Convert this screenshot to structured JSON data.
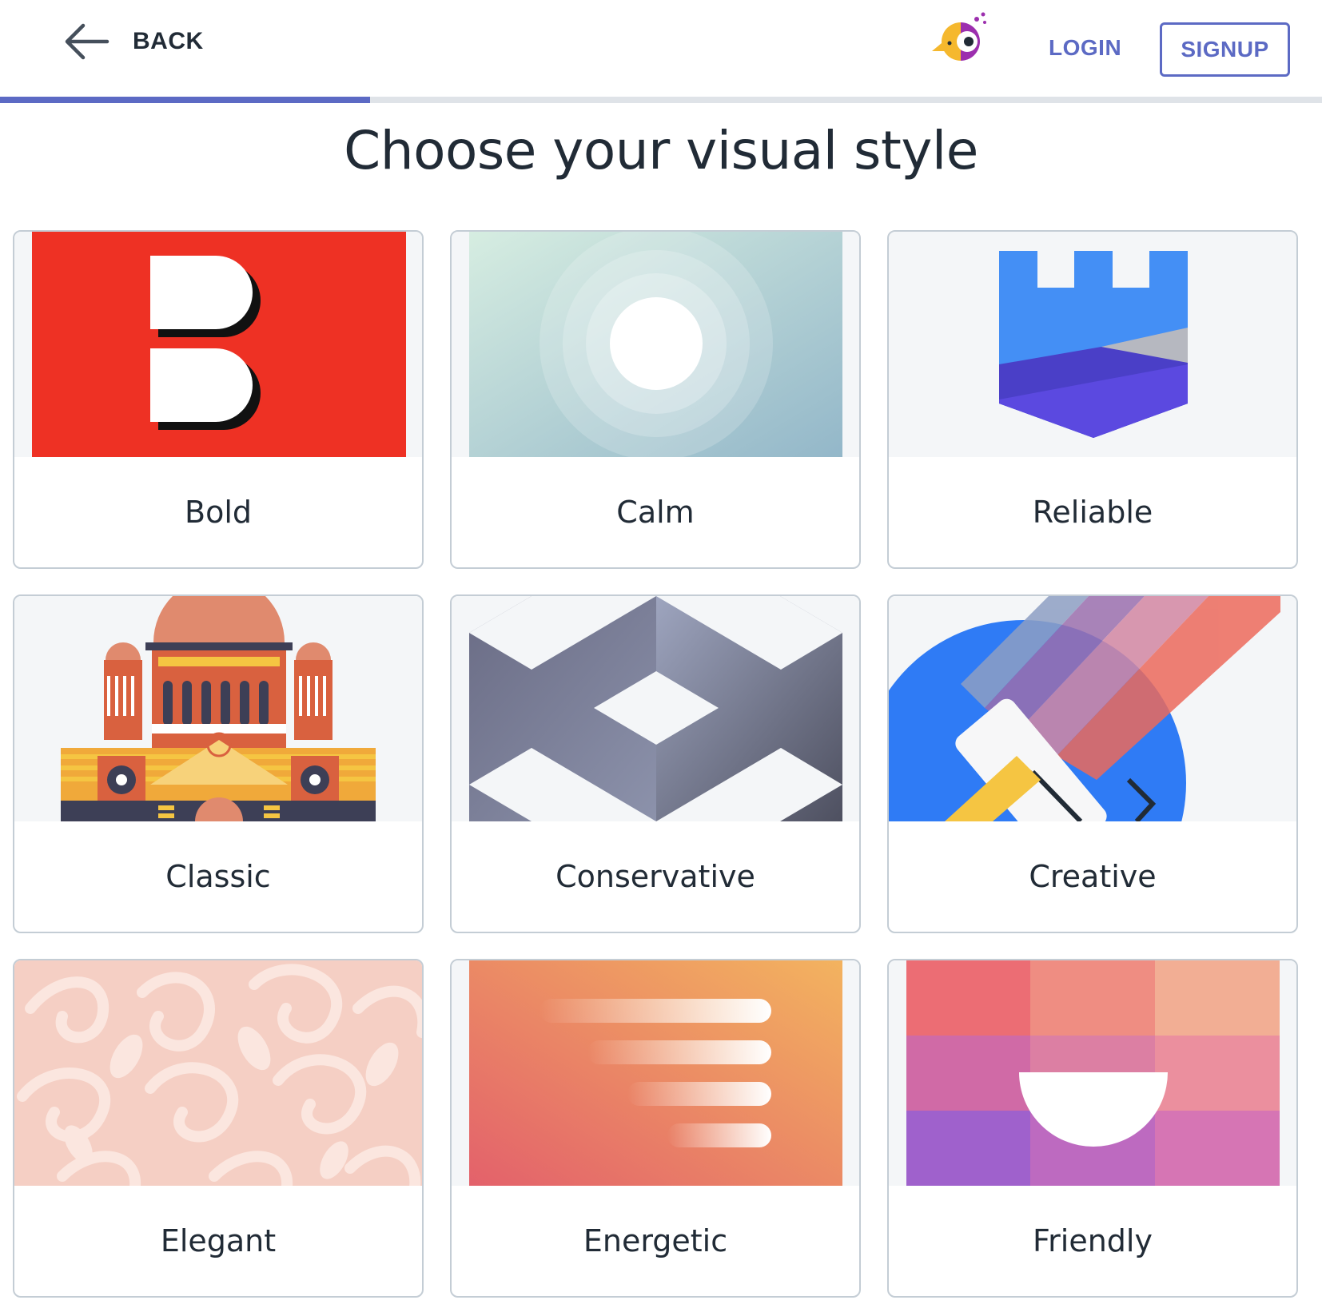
{
  "header": {
    "back_label": "BACK",
    "login_label": "LOGIN",
    "signup_label": "SIGNUP"
  },
  "progress": {
    "fraction": 0.28
  },
  "page_title": "Choose your visual style",
  "styles": [
    {
      "label": "Bold"
    },
    {
      "label": "Calm"
    },
    {
      "label": "Reliable"
    },
    {
      "label": "Classic"
    },
    {
      "label": "Conservative"
    },
    {
      "label": "Creative"
    },
    {
      "label": "Elegant"
    },
    {
      "label": "Energetic"
    },
    {
      "label": "Friendly"
    }
  ],
  "colors": {
    "accent": "#5c6ac4",
    "text": "#212b36",
    "border": "#c4cdd5",
    "progress_track": "#dfe3e8"
  }
}
